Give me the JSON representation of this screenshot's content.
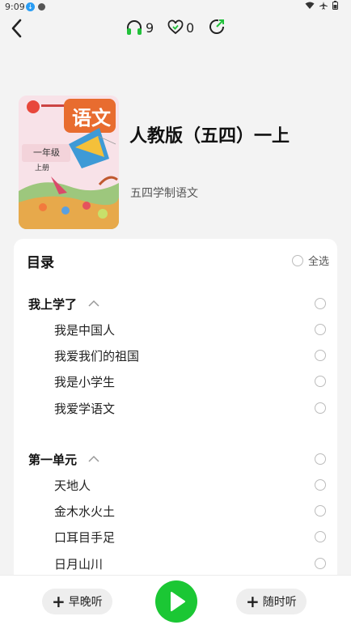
{
  "status_bar": {
    "time": "9:09"
  },
  "topbar": {
    "listen_count": "9",
    "like_count": "0"
  },
  "book": {
    "title": "人教版（五四）一上",
    "subtitle": "五四学制语文",
    "cover_title": "语文",
    "cover_grade": "一年级",
    "cover_volume": "上册"
  },
  "catalog": {
    "title": "目录",
    "select_all_label": "全选",
    "units": [
      {
        "name": "我上学了",
        "lessons": [
          "我是中国人",
          "我爱我们的祖国",
          "我是小学生",
          "我爱学语文"
        ]
      },
      {
        "name": "第一单元",
        "lessons": [
          "天地人",
          "金木水火土",
          "口耳目手足",
          "日月山川"
        ]
      }
    ]
  },
  "bottom_bar": {
    "morning_label": "早晚听",
    "random_label": "随时听"
  },
  "colors": {
    "accent": "#1bc734",
    "listen_icon": "#21c13a"
  }
}
